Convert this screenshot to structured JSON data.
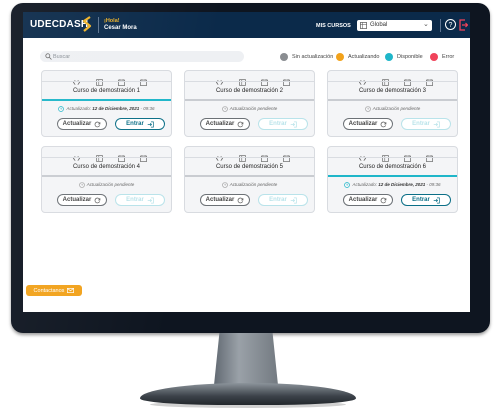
{
  "app": {
    "logo_text": "UDECDASH",
    "greeting": "¡Hola!",
    "user_name": "Cesar Mora"
  },
  "header": {
    "courses_label": "MIS CURSOS",
    "course_select_value": "Global"
  },
  "search": {
    "placeholder": "Buscar"
  },
  "legend": [
    {
      "label": "Sin actualización",
      "color": "#8a8d91"
    },
    {
      "label": "Actualizando",
      "color": "#f2a21b"
    },
    {
      "label": "Disponible",
      "color": "#1fb6c9"
    },
    {
      "label": "Error",
      "color": "#f0435a"
    }
  ],
  "cards": [
    {
      "title": "Curso de demostración 1",
      "status_prefix": "Actualizado:",
      "status_date": "12 de Diciembre, 2021",
      "status_time": "- 09:36",
      "status_pending": "",
      "bar_color": "#1fb6c9",
      "update_label": "Actualizar",
      "enter_label": "Entrar",
      "enter_enabled": true
    },
    {
      "title": "Curso de demostración 2",
      "status_prefix": "",
      "status_date": "",
      "status_time": "",
      "status_pending": "Actualización pendiente",
      "bar_color": "#c9ccd1",
      "update_label": "Actualizar",
      "enter_label": "Entrar",
      "enter_enabled": false
    },
    {
      "title": "Curso de demostración 3",
      "status_prefix": "",
      "status_date": "",
      "status_time": "",
      "status_pending": "Actualización pendiente",
      "bar_color": "#c9ccd1",
      "update_label": "Actualizar",
      "enter_label": "Entrar",
      "enter_enabled": false
    },
    {
      "title": "Curso de demostración 4",
      "status_prefix": "",
      "status_date": "",
      "status_time": "",
      "status_pending": "Actualización pendiente",
      "bar_color": "#c9ccd1",
      "update_label": "Actualizar",
      "enter_label": "Entrar",
      "enter_enabled": false
    },
    {
      "title": "Curso de demostración 5",
      "status_prefix": "",
      "status_date": "",
      "status_time": "",
      "status_pending": "Actualización pendiente",
      "bar_color": "#c9ccd1",
      "update_label": "Actualizar",
      "enter_label": "Entrar",
      "enter_enabled": false
    },
    {
      "title": "Curso de demostración 6",
      "status_prefix": "Actualizado:",
      "status_date": "12 de Diciembre, 2021",
      "status_time": "- 09:36",
      "status_pending": "",
      "bar_color": "#1fb6c9",
      "update_label": "Actualizar",
      "enter_label": "Entrar",
      "enter_enabled": true
    }
  ],
  "contact": {
    "label": "Contactanos"
  }
}
